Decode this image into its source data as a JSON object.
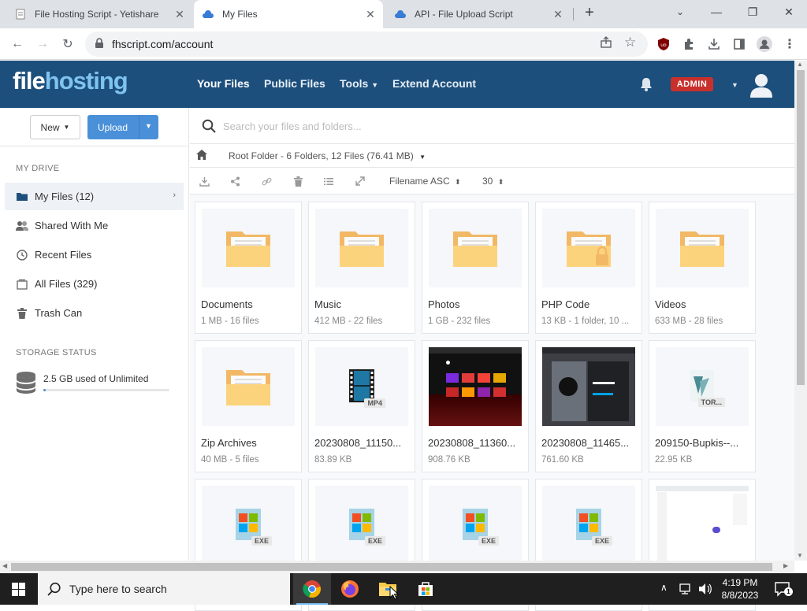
{
  "browser": {
    "tabs": [
      {
        "title": "File Hosting Script - Yetishare",
        "active": false
      },
      {
        "title": "My Files",
        "active": true
      },
      {
        "title": "API - File Upload Script",
        "active": false
      }
    ],
    "url": "fhscript.com/account"
  },
  "app": {
    "logo": {
      "part1": "file",
      "part2": "hosting"
    },
    "nav": [
      "Your Files",
      "Public Files",
      "Tools",
      "Extend Account"
    ],
    "admin_badge": "ADMIN",
    "colors": {
      "header": "#1d4f7c",
      "accent": "#4a90d9",
      "badge": "#c9302c"
    }
  },
  "sidebar": {
    "new_label": "New",
    "upload_label": "Upload",
    "my_drive_heading": "MY DRIVE",
    "items": [
      {
        "label": "My Files (12)",
        "icon": "folder-icon"
      },
      {
        "label": "Shared With Me",
        "icon": "users-icon"
      },
      {
        "label": "Recent Files",
        "icon": "clock-icon"
      },
      {
        "label": "All Files (329)",
        "icon": "files-icon"
      },
      {
        "label": "Trash Can",
        "icon": "trash-icon"
      }
    ],
    "storage_heading": "STORAGE STATUS",
    "storage_text": "2.5 GB used of Unlimited",
    "storage_fraction": 0.02
  },
  "main": {
    "search_placeholder": "Search your files and folders...",
    "breadcrumb": "Root Folder - 6 Folders, 12 Files (76.41 MB)",
    "sort_label": "Filename ASC",
    "per_page": "30",
    "files": [
      {
        "name": "Documents",
        "meta": "1 MB - 16 files",
        "kind": "folder"
      },
      {
        "name": "Music",
        "meta": "412 MB - 22 files",
        "kind": "folder"
      },
      {
        "name": "Photos",
        "meta": "1 GB - 232 files",
        "kind": "folder"
      },
      {
        "name": "PHP Code",
        "meta": "13 KB - 1 folder, 10 ...",
        "kind": "folder-locked"
      },
      {
        "name": "Videos",
        "meta": "633 MB - 28 files",
        "kind": "folder"
      },
      {
        "name": "Zip Archives",
        "meta": "40 MB - 5 files",
        "kind": "folder"
      },
      {
        "name": "20230808_11150...",
        "meta": "83.89 KB",
        "kind": "video",
        "ext": "MP4"
      },
      {
        "name": "20230808_11360...",
        "meta": "908.76 KB",
        "kind": "screenshot-dark"
      },
      {
        "name": "20230808_11465...",
        "meta": "761.60 KB",
        "kind": "screenshot-gray"
      },
      {
        "name": "209150-Bupkis--...",
        "meta": "22.95 KB",
        "kind": "torrent",
        "ext": "TOR..."
      },
      {
        "name": "",
        "meta": "",
        "kind": "exe",
        "ext": "EXE"
      },
      {
        "name": "",
        "meta": "",
        "kind": "exe",
        "ext": "EXE"
      },
      {
        "name": "",
        "meta": "",
        "kind": "exe",
        "ext": "EXE"
      },
      {
        "name": "",
        "meta": "",
        "kind": "exe",
        "ext": "EXE"
      },
      {
        "name": "",
        "meta": "",
        "kind": "screenshot-light"
      }
    ]
  },
  "taskbar": {
    "search_text": "Type here to search",
    "time": "4:19 PM",
    "date": "8/8/2023",
    "notifications": "1"
  }
}
